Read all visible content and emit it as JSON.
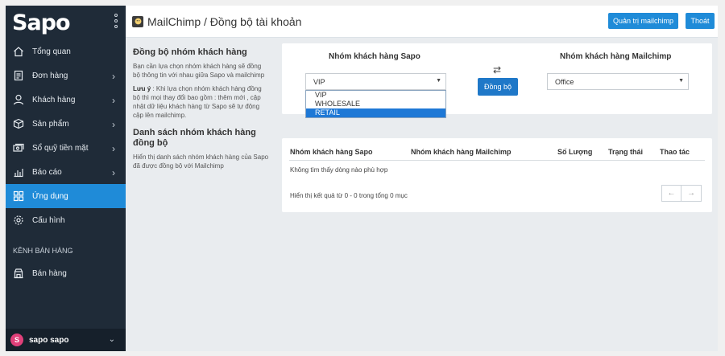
{
  "sidebar": {
    "logo": "Sapo",
    "items": [
      {
        "label": "Tổng quan",
        "icon": "home-icon",
        "chevron": false
      },
      {
        "label": "Đơn hàng",
        "icon": "order-icon",
        "chevron": true
      },
      {
        "label": "Khách hàng",
        "icon": "user-icon",
        "chevron": true
      },
      {
        "label": "Sản phẩm",
        "icon": "box-icon",
        "chevron": true
      },
      {
        "label": "Sổ quỹ tiền mặt",
        "icon": "cash-icon",
        "chevron": true
      },
      {
        "label": "Báo cáo",
        "icon": "chart-icon",
        "chevron": true
      },
      {
        "label": "Ứng dụng",
        "icon": "apps-icon",
        "chevron": false,
        "active": true
      },
      {
        "label": "Cấu hình",
        "icon": "gear-icon",
        "chevron": false
      }
    ],
    "section_title": "KÊNH BÁN HÀNG",
    "channel_item": {
      "label": "Bán hàng",
      "icon": "store-icon"
    },
    "user": {
      "initial": "S",
      "name": "sapo sapo"
    }
  },
  "header": {
    "title": "MailChimp / Đồng bộ tài khoản",
    "manage_button": "Quản trị mailchimp",
    "logout_button": "Thoát"
  },
  "info": {
    "sync_heading": "Đồng bộ nhóm khách hàng",
    "sync_desc": "Bạn cần lựa chọn nhóm khách hàng sẽ đồng bộ thông tin với nhau giữa Sapo và mailchimp",
    "note_label": "Lưu ý",
    "note_text": " : Khi lựa chọn nhóm khách hàng đồng bộ thì mọi thay đổi bao gồm : thêm mới , cập nhật dữ liệu khách hàng từ Sapo sẽ tự động cập lên mailchimp.",
    "list_heading": "Danh sách nhóm khách hàng đồng bộ",
    "list_desc": "Hiển thị danh sách nhóm khách hàng của Sapo đã được đồng bộ với Mailchimp"
  },
  "sync": {
    "sapo_title": "Nhóm khách hàng Sapo",
    "mailchimp_title": "Nhóm khách hàng Mailchimp",
    "sapo_selected": "VIP",
    "sapo_options": [
      "VIP",
      "WHOLESALE",
      "RETAIL"
    ],
    "sapo_highlighted": "RETAIL",
    "mailchimp_selected": "Office",
    "sync_button": "Đồng bộ"
  },
  "table": {
    "columns": [
      "Nhóm khách hàng Sapo",
      "Nhóm khách hàng Mailchimp",
      "Số Lượng",
      "Trạng thái",
      "Thao tác"
    ],
    "empty_text": "Không tìm thấy dòng nào phù hợp",
    "paging_text": "Hiển thị kết quả từ 0 - 0 trong tổng 0 mục",
    "prev": "←",
    "next": "→"
  },
  "colors": {
    "sidebar": "#1f2b38",
    "accent": "#1f8bd8",
    "highlight": "#1e78d6"
  }
}
